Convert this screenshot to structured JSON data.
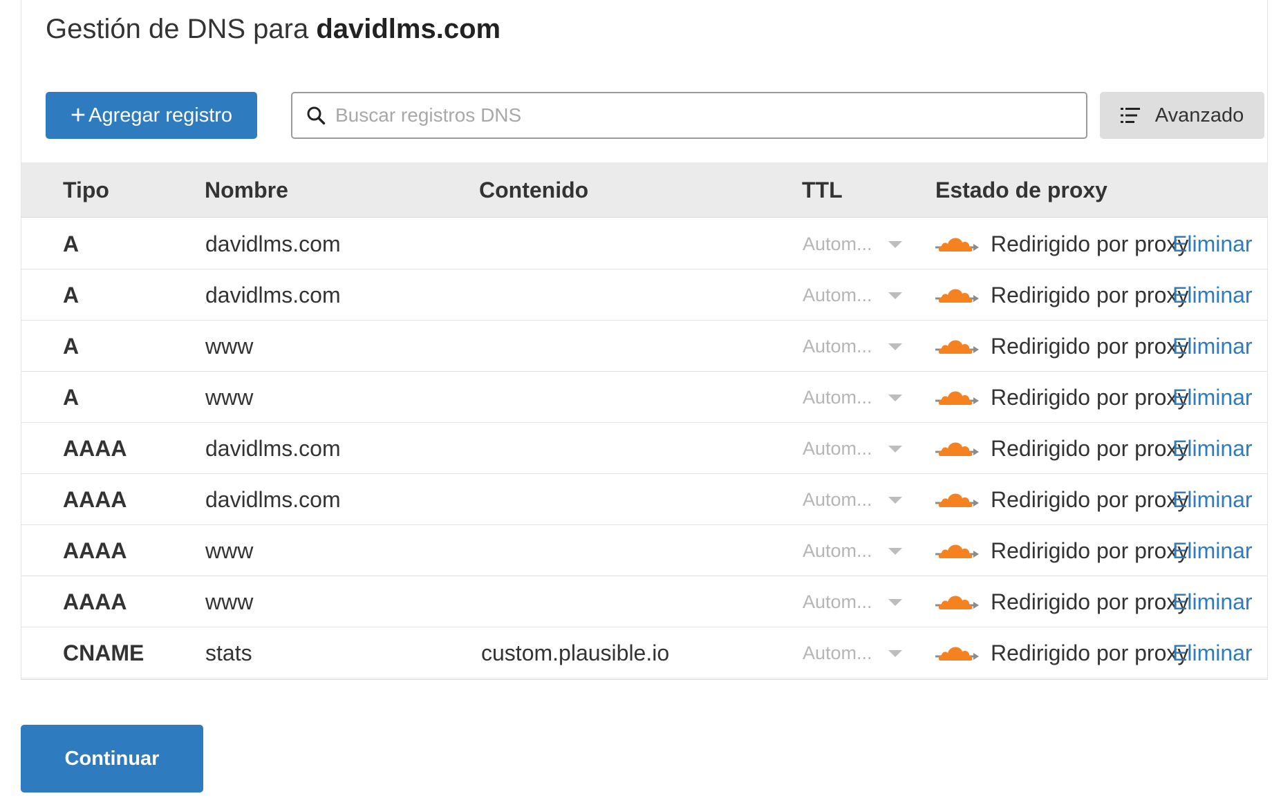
{
  "page": {
    "title_prefix": "Gestión de DNS para",
    "title_domain": "davidlms.com"
  },
  "toolbar": {
    "add_label": "Agregar registro",
    "search_placeholder": "Buscar registros DNS",
    "advanced_label": "Avanzado"
  },
  "table": {
    "headers": {
      "type": "Tipo",
      "name": "Nombre",
      "content": "Contenido",
      "ttl": "TTL",
      "proxy": "Estado de proxy"
    },
    "rows": [
      {
        "type": "A",
        "name": "davidlms.com",
        "content": "",
        "ttl": "Autom...",
        "proxy": "Redirigido por proxy",
        "action": "Eliminar"
      },
      {
        "type": "A",
        "name": "davidlms.com",
        "content": "",
        "ttl": "Autom...",
        "proxy": "Redirigido por proxy",
        "action": "Eliminar"
      },
      {
        "type": "A",
        "name": "www",
        "content": "",
        "ttl": "Autom...",
        "proxy": "Redirigido por proxy",
        "action": "Eliminar"
      },
      {
        "type": "A",
        "name": "www",
        "content": "",
        "ttl": "Autom...",
        "proxy": "Redirigido por proxy",
        "action": "Eliminar"
      },
      {
        "type": "AAAA",
        "name": "davidlms.com",
        "content": "",
        "ttl": "Autom...",
        "proxy": "Redirigido por proxy",
        "action": "Eliminar"
      },
      {
        "type": "AAAA",
        "name": "davidlms.com",
        "content": "",
        "ttl": "Autom...",
        "proxy": "Redirigido por proxy",
        "action": "Eliminar"
      },
      {
        "type": "AAAA",
        "name": "www",
        "content": "",
        "ttl": "Autom...",
        "proxy": "Redirigido por proxy",
        "action": "Eliminar"
      },
      {
        "type": "AAAA",
        "name": "www",
        "content": "",
        "ttl": "Autom...",
        "proxy": "Redirigido por proxy",
        "action": "Eliminar"
      },
      {
        "type": "CNAME",
        "name": "stats",
        "content": "custom.plausible.io",
        "ttl": "Autom...",
        "proxy": "Redirigido por proxy",
        "action": "Eliminar"
      }
    ]
  },
  "footer": {
    "continue_label": "Continuar"
  },
  "colors": {
    "primary": "#2f7bbf",
    "proxy_cloud": "#f6821f",
    "header_bg": "#ebebeb"
  },
  "icons": {
    "add": "plus-icon",
    "search": "search-icon",
    "advanced": "list-filter-icon",
    "proxy": "proxied-cloud-icon",
    "ttl_dropdown": "caret-down-icon"
  }
}
